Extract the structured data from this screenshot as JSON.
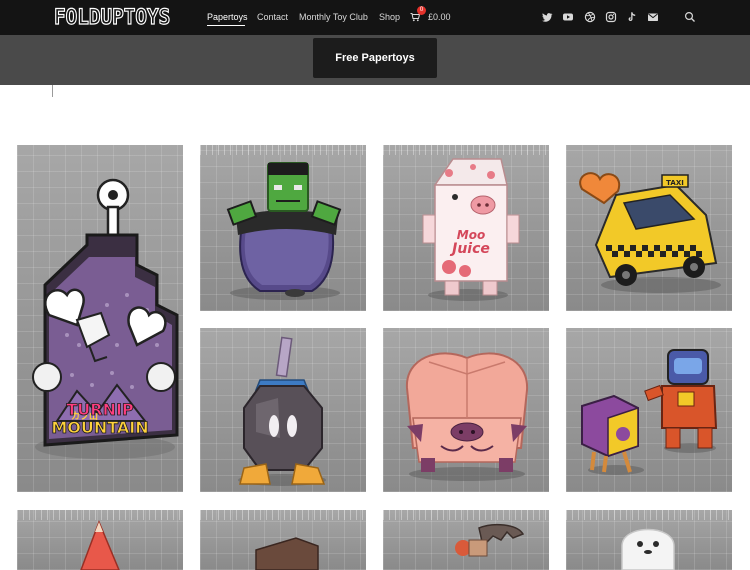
{
  "brand": {
    "logo_text": "FOLDUPTOYS"
  },
  "nav": {
    "items": [
      {
        "label": "Papertoys",
        "active": true
      },
      {
        "label": "Contact"
      },
      {
        "label": "Monthly Toy Club"
      },
      {
        "label": "Shop"
      }
    ],
    "cart": {
      "count": "0",
      "amount": "£0.00"
    },
    "social_icons": [
      "twitter-icon",
      "youtube-icon",
      "dribbble-icon",
      "instagram-icon",
      "tiktok-icon",
      "email-icon"
    ],
    "search_icon": "search-icon"
  },
  "hero": {
    "button_label": "Free Papertoys"
  },
  "products": [
    {
      "name": "turnip-mountain",
      "label_line1": "TURNIP",
      "label_line2": "MOUNTAIN",
      "label_kana": "カブ山"
    },
    {
      "name": "frankenstein-cauldron"
    },
    {
      "name": "pig-milk-carton",
      "carton_line1": "Moo",
      "carton_line2": "Juice"
    },
    {
      "name": "yellow-taxi",
      "sign": "TAXI"
    },
    {
      "name": "bob-omb"
    },
    {
      "name": "pink-pig"
    },
    {
      "name": "astronaut-and-cube"
    },
    {
      "name": "red-cone"
    },
    {
      "name": "brown-block"
    },
    {
      "name": "bat"
    },
    {
      "name": "ghost"
    }
  ],
  "colors": {
    "nav_bg": "#141414",
    "subbar_bg": "#4a4a4a",
    "button_bg": "#1c1c1c",
    "cart_badge": "#e4322b"
  }
}
